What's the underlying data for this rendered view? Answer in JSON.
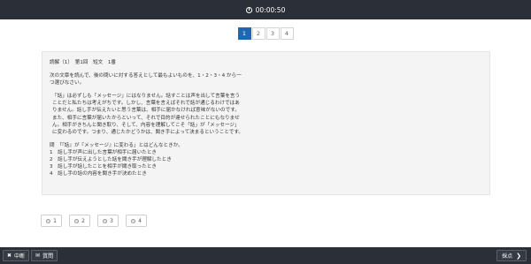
{
  "timer": "00:00:50",
  "pages": [
    "1",
    "2",
    "3",
    "4"
  ],
  "passage": {
    "heading": "読解（1）　第1回　短文　1番",
    "instruction": [
      "次の文章を読んで、後の問いに対する答えとして最もよいものを、1・2・3・4 から一",
      "つ選びなさい。"
    ],
    "body": [
      "「話」は必ずしも「メッセージ」にはなりません。話すことは声を出して言葉を言う",
      "ことだと私たちは考えがちです。しかし、言葉を言えばそれで話が通じるわけではあ",
      "りません。話し手が伝えたいと思う言葉は、相手に届かなければ意味がないのです。",
      "また、相手に言葉が届いたからといって、それで目的が達せられたことにもなりませ",
      "ん。相手がきちんと聞き取り、そして、内容を理解してこそ「話」が「メッセージ」",
      "に変わるのです。つまり、通じたかどうかは、聞き手によって決まるということです。"
    ],
    "question": "問　「『話』が『メッセージ』に変わる」とはどんなときか。",
    "options": [
      "1　話し手が声に出した言葉が相手に届いたとき",
      "2　話し手が伝えようとした話を聞き手が理解したとき",
      "3　話し手が話したことを相手が聞き取ったとき",
      "4　話し手の話の内容を聞き手が決めたとき"
    ]
  },
  "choices": [
    "1",
    "2",
    "3",
    "4"
  ],
  "bottom": {
    "suspend_label": "中断",
    "memo_label": "質問",
    "grade_label": "採点"
  }
}
